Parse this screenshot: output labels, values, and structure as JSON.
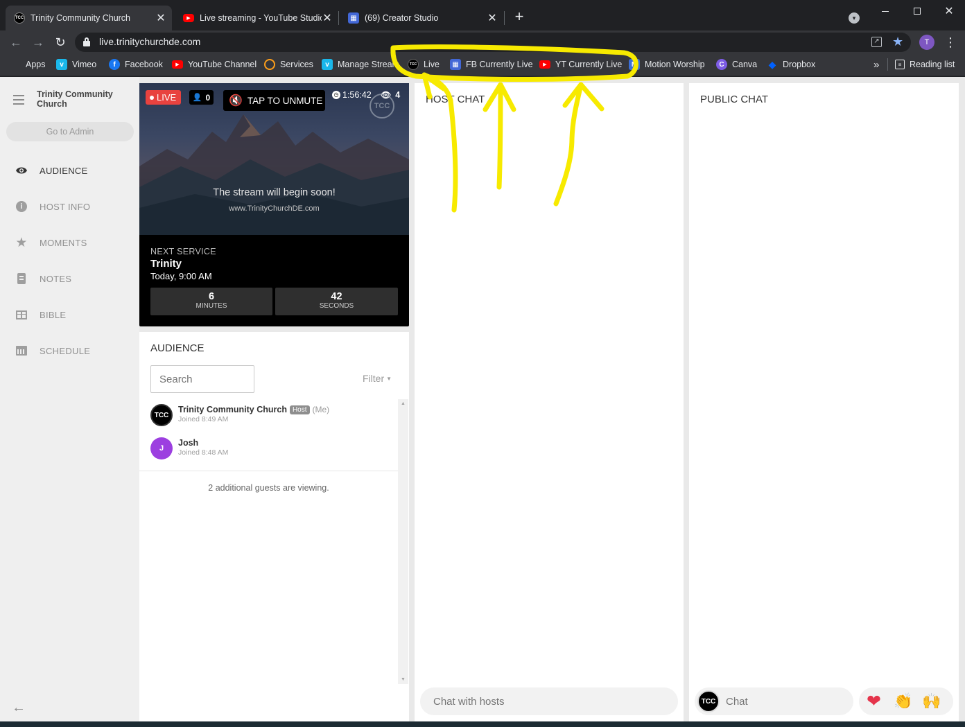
{
  "browser": {
    "tabs": [
      {
        "title": "Trinity Community Church",
        "favicon": "TCC"
      },
      {
        "title": "Live streaming - YouTube Studio"
      },
      {
        "title": "(69) Creator Studio"
      }
    ],
    "url": "live.trinitychurchde.com",
    "profile_initial": "T",
    "bookmarks": [
      {
        "label": "Apps",
        "icon": "apps-grid-icon"
      },
      {
        "label": "Vimeo",
        "icon": "vimeo-icon",
        "color": "#1ab7ea",
        "glyph": "v"
      },
      {
        "label": "Facebook",
        "icon": "facebook-icon",
        "color": "#1877f2",
        "glyph": "f"
      },
      {
        "label": "YouTube Channel",
        "icon": "youtube-icon",
        "color": "#ff0000",
        "glyph": "▶"
      },
      {
        "label": "Services",
        "icon": "planning-center-icon",
        "color": "#ff9f1a",
        "glyph": ""
      },
      {
        "label": "Manage Stream",
        "icon": "vimeo-icon",
        "color": "#1ab7ea",
        "glyph": "v"
      },
      {
        "label": "Live",
        "icon": "tcc-icon",
        "color": "#000000",
        "glyph": "TCC"
      },
      {
        "label": "FB Currently Live",
        "icon": "creator-studio-icon",
        "color": "#4267d6",
        "glyph": "▦"
      },
      {
        "label": "YT Currently Live",
        "icon": "youtube-icon",
        "color": "#ff0000",
        "glyph": "▶"
      },
      {
        "label": "Motion Worship",
        "icon": "motion-worship-icon",
        "color": "#3b6fd8",
        "glyph": "M"
      },
      {
        "label": "Canva",
        "icon": "canva-icon",
        "color": "#7d5ce6",
        "glyph": "C"
      },
      {
        "label": "Dropbox",
        "icon": "dropbox-icon",
        "color": "#0061ff",
        "glyph": "◆"
      }
    ],
    "overflow": "»",
    "reading_list": "Reading list"
  },
  "sidebar": {
    "org_name": "Trinity Community Church",
    "admin_button": "Go to Admin",
    "items": [
      {
        "label": "AUDIENCE",
        "icon": "eye-icon",
        "glyph": "👁",
        "active": true
      },
      {
        "label": "HOST INFO",
        "icon": "info-icon",
        "glyph": "ℹ",
        "active": false
      },
      {
        "label": "MOMENTS",
        "icon": "star-icon",
        "glyph": "★",
        "active": false
      },
      {
        "label": "NOTES",
        "icon": "notes-icon",
        "glyph": "▤",
        "active": false
      },
      {
        "label": "BIBLE",
        "icon": "bible-icon",
        "glyph": "▥",
        "active": false
      },
      {
        "label": "SCHEDULE",
        "icon": "calendar-icon",
        "glyph": "▦",
        "active": false
      }
    ],
    "collapse_icon": "←"
  },
  "player": {
    "live_badge": "LIVE",
    "host_count": "0",
    "unmute_label": "TAP TO UNMUTE",
    "elapsed": "1:56:42",
    "viewers": "4",
    "watermark": "TCC",
    "message": "The stream will begin soon!",
    "website": "www.TrinityChurchDE.com"
  },
  "next_service": {
    "heading": "NEXT SERVICE",
    "name": "Trinity",
    "time": "Today, 9:00 AM",
    "countdown": [
      {
        "value": "6",
        "unit": "MINUTES"
      },
      {
        "value": "42",
        "unit": "SECONDS"
      }
    ]
  },
  "audience": {
    "title": "AUDIENCE",
    "search_placeholder": "Search",
    "filter_label": "Filter",
    "members": [
      {
        "name": "Trinity Community Church",
        "badge": "Host",
        "me": "(Me)",
        "joined": "Joined 8:49 AM",
        "avatar": "TCC",
        "avatar_color": "#000000"
      },
      {
        "name": "Josh",
        "badge": "",
        "me": "",
        "joined": "Joined 8:48 AM",
        "avatar": "J",
        "avatar_color": "#9c3fe0"
      }
    ],
    "guests_note": "2 additional guests are viewing."
  },
  "host_chat": {
    "title": "HOST CHAT",
    "input_placeholder": "Chat with hosts"
  },
  "public_chat": {
    "title": "PUBLIC CHAT",
    "avatar": "TCC",
    "input_placeholder": "Chat",
    "reactions": [
      {
        "emoji": "❤",
        "name": "heart-reaction"
      },
      {
        "emoji": "👏",
        "name": "clap-reaction"
      },
      {
        "emoji": "🙌",
        "name": "raised-hands-reaction"
      }
    ]
  },
  "colors": {
    "live_red": "#e8423f",
    "annotation_yellow": "#f7ea00",
    "chrome_dark": "#202124",
    "chrome_toolbar": "#35363a"
  }
}
